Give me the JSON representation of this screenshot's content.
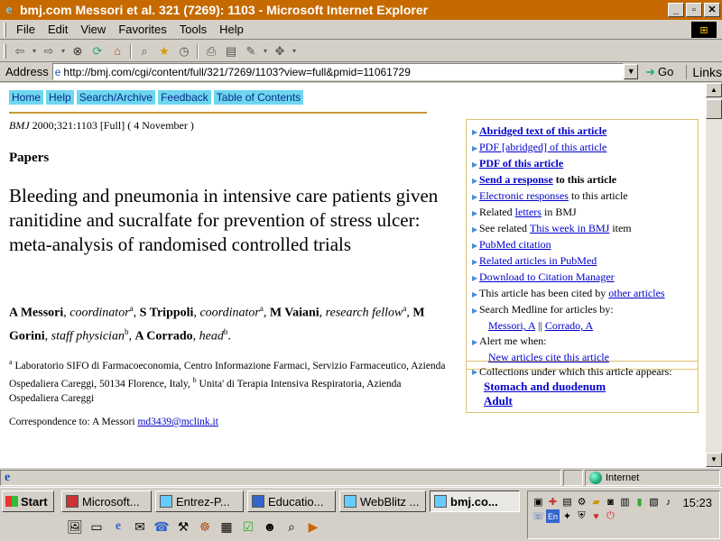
{
  "window": {
    "title": "bmj.com Messori et al. 321 (7269): 1103 - Microsoft Internet Explorer"
  },
  "menu": [
    "File",
    "Edit",
    "View",
    "Favorites",
    "Tools",
    "Help"
  ],
  "address": {
    "label": "Address",
    "url": "http://bmj.com/cgi/content/full/321/7269/1103?view=full&pmid=11061729",
    "go": "Go",
    "links": "Links"
  },
  "nav": [
    "Home",
    "Help",
    "Search/Archive",
    "Feedback",
    "Table of Contents"
  ],
  "article": {
    "cite_journal": "BMJ",
    "cite_text": " 2000;321:1103 [Full] ( 4 November )",
    "section": "Papers",
    "headline": "Bleeding and pneumonia in intensive care patients given ranitidine and sucralfate for prevention of stress ulcer: meta-analysis of randomised controlled trials",
    "authors": [
      {
        "name": "A Messori",
        "role": "coordinator",
        "sup": "a"
      },
      {
        "name": "S Trippoli",
        "role": "coordinator",
        "sup": "a"
      },
      {
        "name": "M Vaiani",
        "role": "research fellow",
        "sup": "a"
      },
      {
        "name": "M Gorini",
        "role": "staff physician",
        "sup": "b"
      },
      {
        "name": "A Corrado",
        "role": "head",
        "sup": "b"
      }
    ],
    "affiliation_a_sup": "a",
    "affiliation_a": " Laboratorio SIFO di Farmacoeconomia, Centro Informazione Farmaci, Servizio Farmaceutico, Azienda Ospedaliera Careggi, 50134 Florence, Italy, ",
    "affiliation_b_sup": "b",
    "affiliation_b": " Unita' di Terapia Intensiva Respiratoria, Azienda Ospedaliera Careggi",
    "correspondence_label": "Correspondence to: A Messori ",
    "correspondence_email": "md3439@mclink.it"
  },
  "sidebar": {
    "abridged": "Abridged text of this article",
    "pdf_abridged": "PDF [abridged] of this article",
    "pdf": "PDF of this article",
    "send_response": "Send a response",
    "send_response_rest": " to this article",
    "electronic_responses": "Electronic responses",
    "electronic_responses_rest": " to this article",
    "related_pre": "Related ",
    "related_link": "letters",
    "related_post": " in BMJ",
    "see_related_pre": "See related ",
    "see_related_link": "This week in BMJ",
    "see_related_post": " item",
    "pubmed_citation": "PubMed citation",
    "related_pubmed": "Related articles in PubMed",
    "download_citation": "Download to Citation Manager",
    "cited_pre": "This article has been cited by ",
    "cited_link": "other articles",
    "search_medline": "Search Medline for articles by:",
    "medline_author_1": "Messori, A",
    "medline_sep": " || ",
    "medline_author_2": "Corrado, A",
    "alert": "Alert me when:",
    "alert_link": "New articles cite this article"
  },
  "collections": {
    "label": "Collections under which this article appears:",
    "items": [
      "Stomach and duodenum",
      "Adult"
    ]
  },
  "status": {
    "zone": "Internet"
  },
  "taskbar": {
    "start": "Start",
    "tasks": [
      "Microsoft...",
      "Entrez-P...",
      "Educatio...",
      "WebBlitz ...",
      "bmj.co..."
    ],
    "clock": "15:23"
  }
}
